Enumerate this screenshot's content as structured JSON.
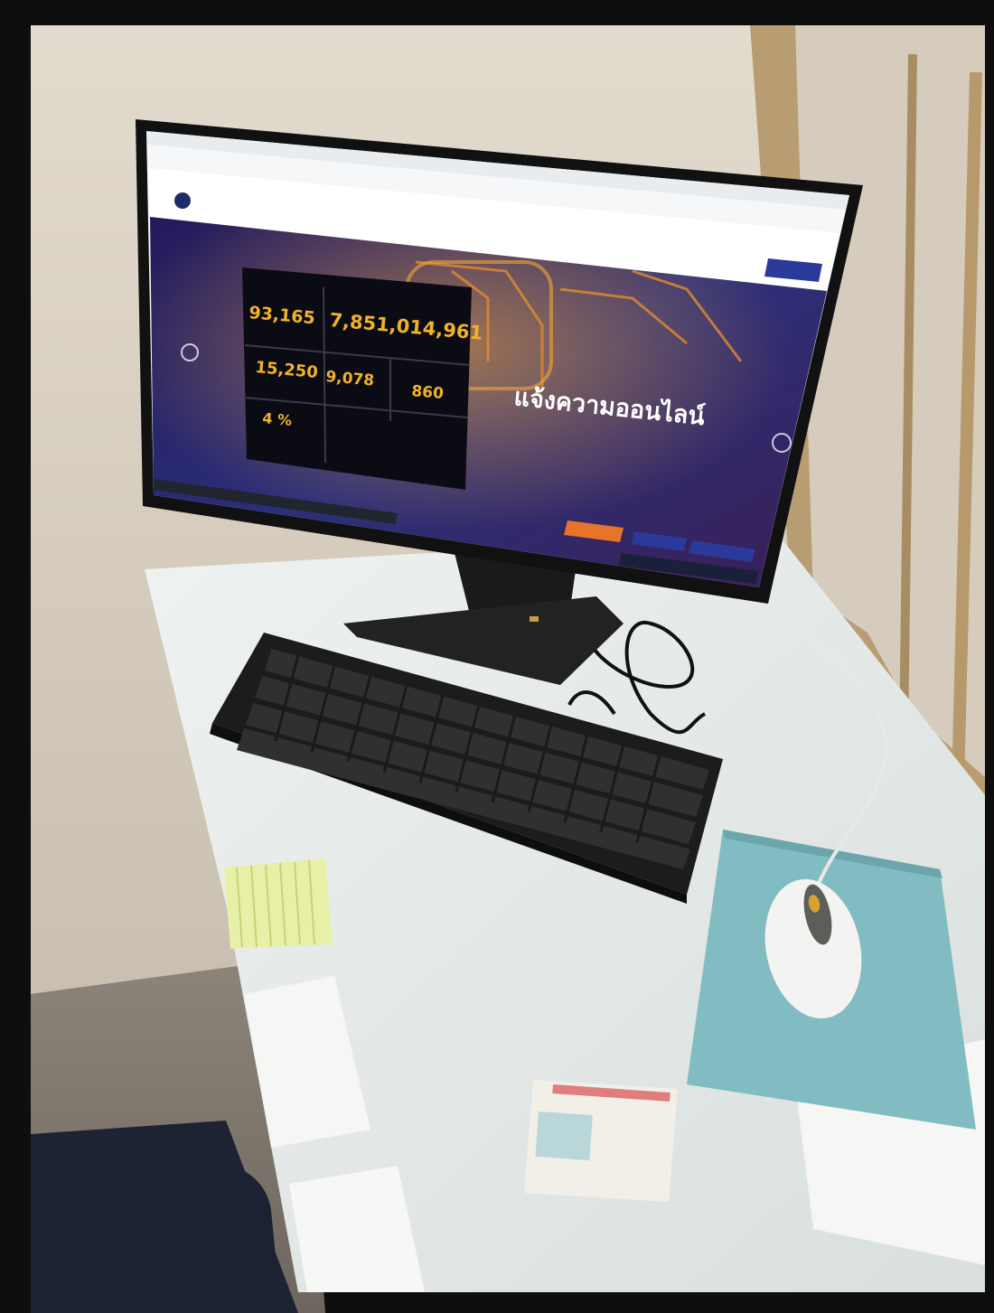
{
  "stats": {
    "total_cases": "93,165",
    "total_damage": "7,851,014,961",
    "stat_a": "15,250",
    "stat_b": "9,078",
    "stat_c": "860",
    "percent": "4 %"
  },
  "hero": {
    "title": "แจ้งความออนไลน์"
  },
  "colors": {
    "wall": "#d8cfc2",
    "desk": "#e8eceb",
    "mousepad": "#7fbcc0",
    "accent_gold": "#f0b22a",
    "hero_bg": "#1f2a6b",
    "button_orange": "#e8742a"
  },
  "icons": [
    "monitor-icon",
    "keyboard-icon",
    "mouse-icon"
  ]
}
